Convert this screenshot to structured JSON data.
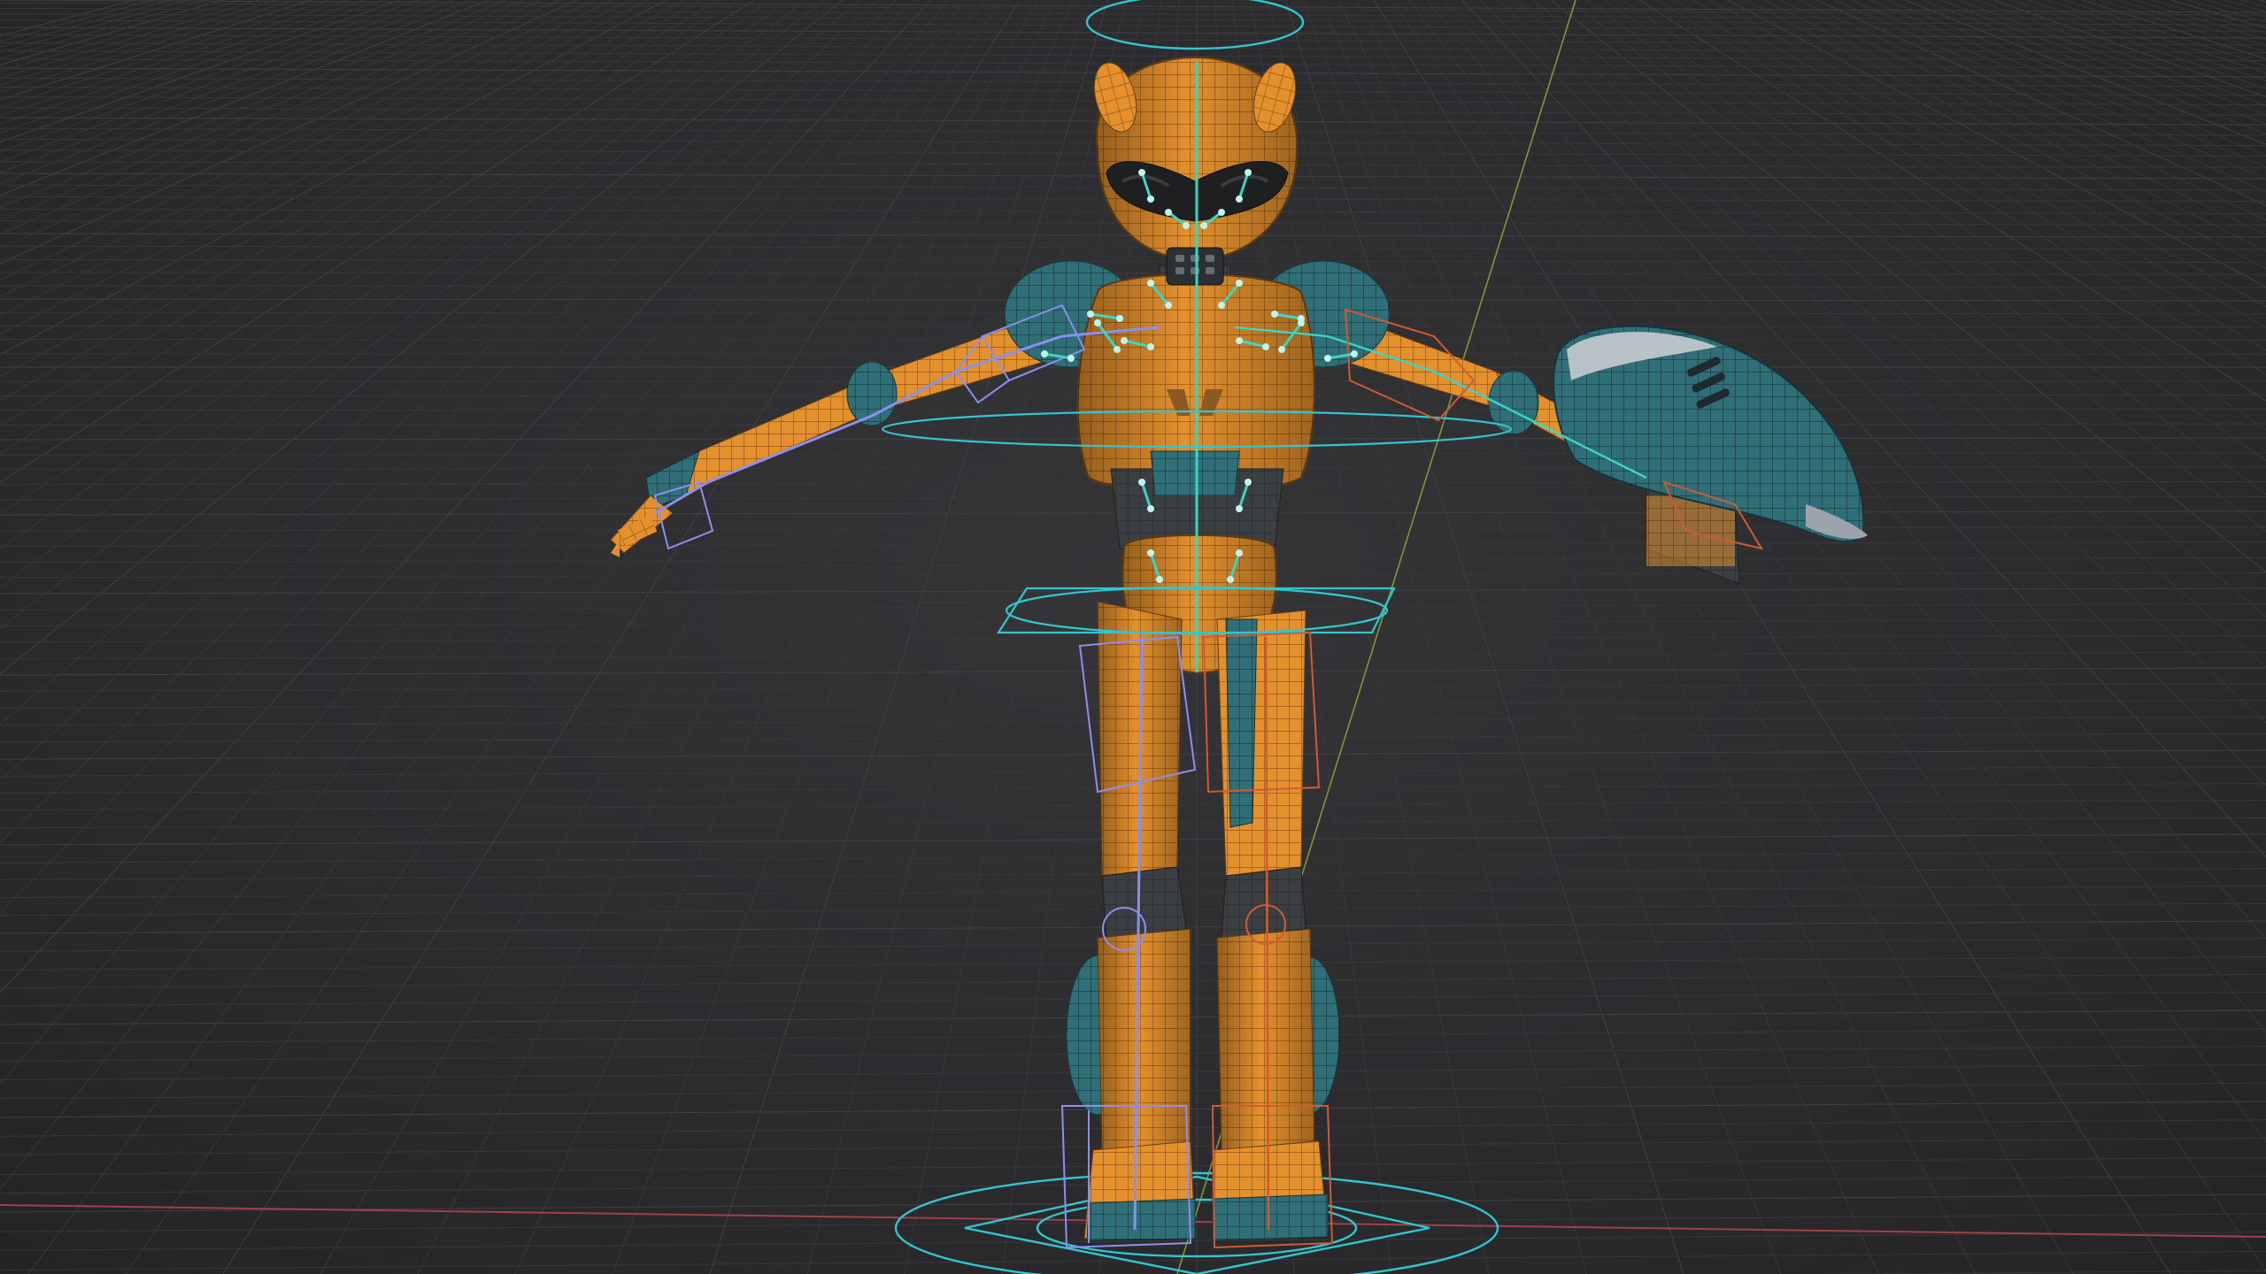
{
  "viewport": {
    "mode": "3d-viewport",
    "colors": {
      "background": "#2c2c2f",
      "grid_line": "#3a3a3d",
      "grid_major": "#434347",
      "axis_x": "#a0404a",
      "axis_y": "#7c9a3a",
      "body_orange": "#e4902c",
      "body_orange_dark": "#b36a18",
      "body_teal": "#2f6f78",
      "body_teal_light": "#4f98a2",
      "body_dark": "#3c3f42",
      "wire_dark": "#5a3a12",
      "bone_cyan": "#39d6c4",
      "control_cyan": "#31c6d0",
      "control_blue": "#8a8ff0",
      "control_red": "#d05a34"
    }
  },
  "objects": {
    "character": {
      "name_icon": "robot-character-mesh",
      "pose": "T-pose"
    },
    "armature": {
      "name_icon": "armature-rig"
    },
    "accessory": {
      "name_icon": "arm-cannon-mesh"
    }
  }
}
